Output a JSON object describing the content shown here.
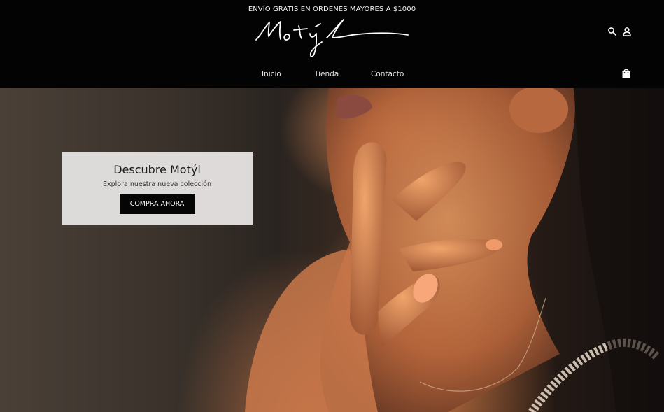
{
  "announcement": "ENVÍO GRATIS EN ORDENES MAYORES A $1000",
  "brand": {
    "logo_text": "Motýl"
  },
  "icons": {
    "search": "search-icon",
    "account": "user-icon",
    "cart": "shopping-bag-icon"
  },
  "nav": {
    "items": [
      {
        "label": "Inicio"
      },
      {
        "label": "Tienda"
      },
      {
        "label": "Contacto"
      }
    ]
  },
  "hero": {
    "image": "woman-touching-chin-photo",
    "promo": {
      "title": "Descubre Motýl",
      "subtitle": "Explora nuestra nueva colección",
      "button_label": "COMPRA AHORA"
    }
  },
  "colors": {
    "header_bg": "#030304",
    "button_bg": "#050505",
    "promo_bg": "#e4e2e1"
  }
}
